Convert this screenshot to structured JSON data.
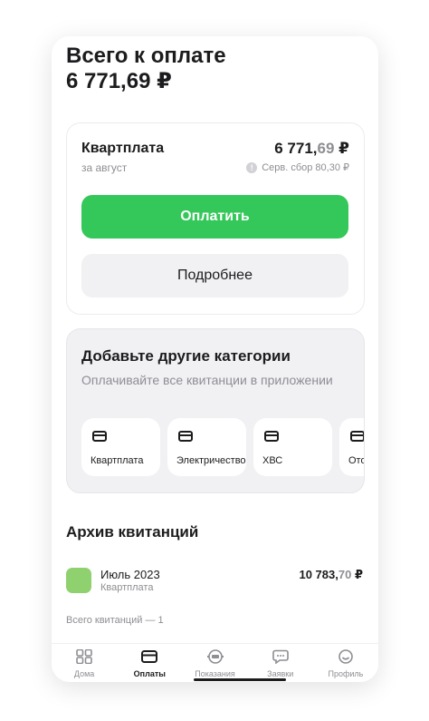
{
  "header": {
    "total_label": "Всего к оплате",
    "total_amount": "6 771,69 ₽"
  },
  "payment_card": {
    "title": "Квартплата",
    "subtitle": "за август",
    "amount_main": "6 771,",
    "amount_kopecks": "69",
    "amount_currency": " ₽",
    "fee": "Серв. сбор 80,30 ₽",
    "pay_button": "Оплатить",
    "details_button": "Подробнее"
  },
  "add_categories": {
    "title": "Добавьте другие категории",
    "subtitle": "Оплачивайте все квитанции в приложении",
    "items": [
      {
        "label": "Квартплата",
        "icon": "card-icon"
      },
      {
        "label": "Электричество",
        "icon": "card-icon"
      },
      {
        "label": "ХВС",
        "icon": "card-icon"
      },
      {
        "label": "Отопление",
        "icon": "card-icon"
      }
    ]
  },
  "archive": {
    "title": "Архив квитанций",
    "items": [
      {
        "month": "Июль 2023",
        "category": "Квартплата",
        "amount_main": "10 783,",
        "amount_kopecks": "70",
        "amount_currency": " ₽"
      }
    ],
    "count_text": "Всего квитанций — 1"
  },
  "tabbar": {
    "tabs": [
      {
        "label": "Дома",
        "icon": "grid-icon",
        "active": false
      },
      {
        "label": "Оплаты",
        "icon": "card-icon",
        "active": true
      },
      {
        "label": "Показания",
        "icon": "meter-icon",
        "active": false
      },
      {
        "label": "Заявки",
        "icon": "chat-icon",
        "active": false
      },
      {
        "label": "Профиль",
        "icon": "smile-icon",
        "active": false
      }
    ]
  },
  "colors": {
    "accent_green": "#34c759",
    "background": "#ffffff",
    "muted_text": "#8e8e93"
  }
}
